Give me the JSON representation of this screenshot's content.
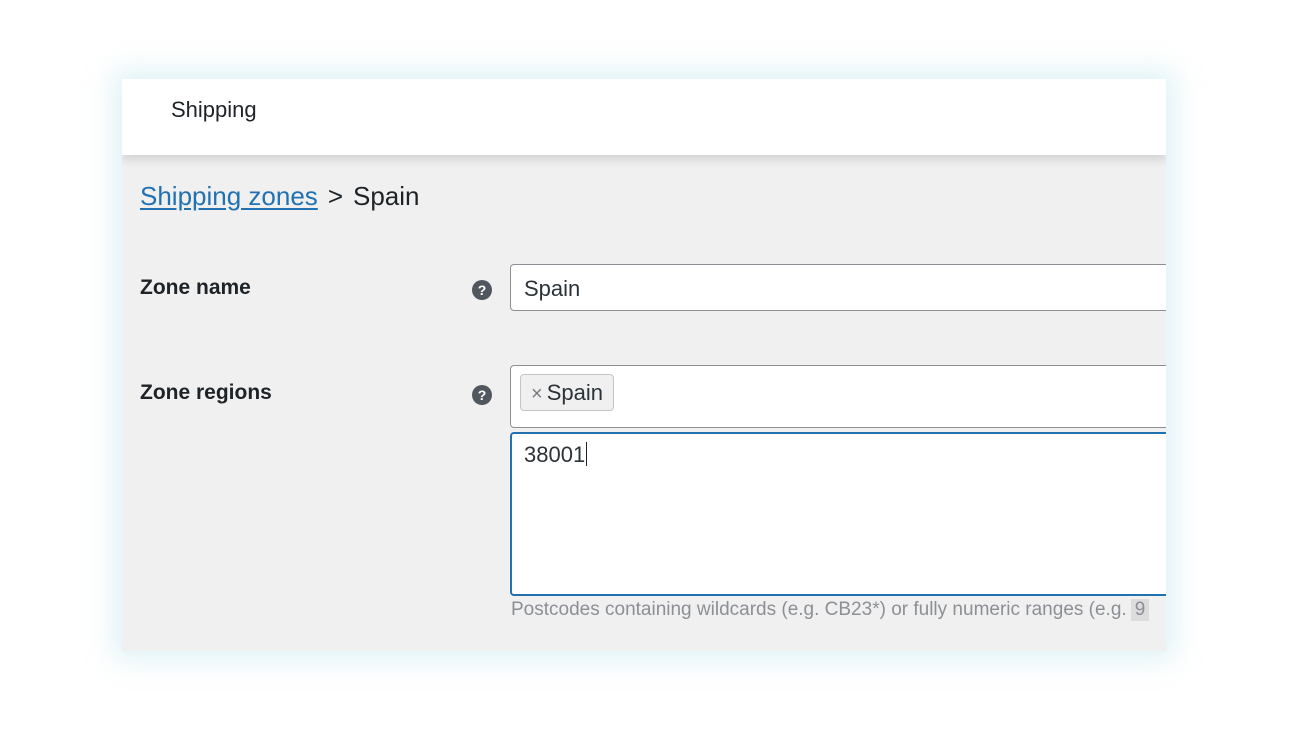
{
  "header": {
    "title": "Shipping"
  },
  "breadcrumb": {
    "parent_link": "Shipping zones",
    "separator": ">",
    "current": "Spain"
  },
  "zone_name": {
    "label": "Zone name",
    "help_icon": "?",
    "value": "Spain"
  },
  "zone_regions": {
    "label": "Zone regions",
    "help_icon": "?",
    "chip_remove": "×",
    "chip_label": "Spain",
    "postcodes_value": "38001",
    "hint": "Postcodes containing wildcards (e.g. CB23*) or fully numeric ranges (e.g.",
    "hint_code": "9"
  }
}
